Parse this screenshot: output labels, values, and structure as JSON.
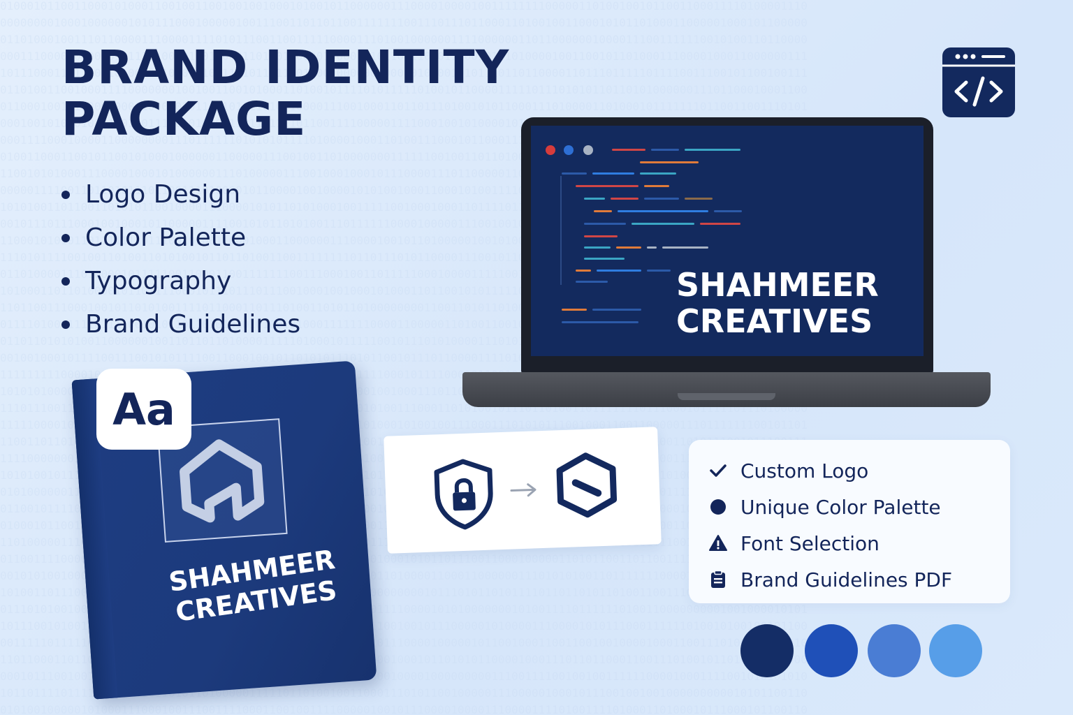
{
  "title": {
    "line1": "BRAND IDENTITY",
    "line2": "PACKAGE"
  },
  "features": [
    "Logo Design",
    "Color Palette",
    "Typography",
    "Brand Guidelines"
  ],
  "laptop": {
    "brand_line1": "SHAHMEER",
    "brand_line2": "CREATIVES"
  },
  "book": {
    "brand_line1": "SHAHMEER",
    "brand_line2": "CREATIVES",
    "badge": "Aa"
  },
  "checklist": [
    {
      "icon": "check-icon",
      "label": "Custom Logo"
    },
    {
      "icon": "circle-icon",
      "label": "Unique Color Palette"
    },
    {
      "icon": "warning-icon",
      "label": "Font Selection"
    },
    {
      "icon": "clipboard-icon",
      "label": "Brand Guidelines PDF"
    }
  ],
  "palette": [
    "#142d66",
    "#1f50b8",
    "#4a7dd4",
    "#579ee8"
  ],
  "colors": {
    "navy": "#13255a",
    "background": "#dde9fb",
    "screen": "#132a5e"
  }
}
